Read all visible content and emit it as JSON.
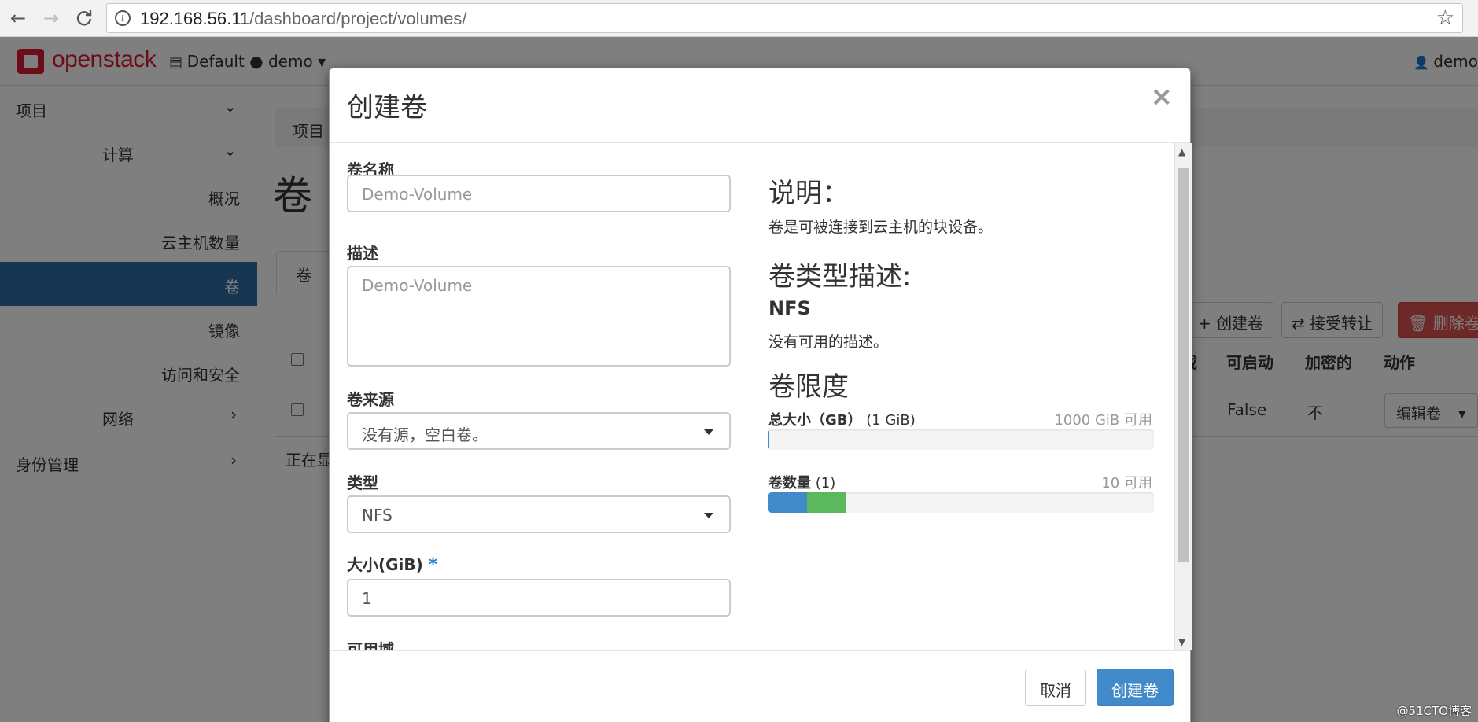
{
  "browser": {
    "back": "←",
    "forward": "→",
    "reload": "C",
    "info": "i",
    "url_host": "192.168.56.11",
    "url_path": "/dashboard/project/volumes/",
    "star": "☆"
  },
  "navbar": {
    "logo": "openstack",
    "project_selector": "Default ● demo ▾",
    "user": "demo"
  },
  "sidebar": {
    "items": [
      {
        "label": "项目",
        "chevron": "⌄"
      },
      {
        "label": "计算",
        "chevron": "⌄"
      },
      {
        "label": "概况"
      },
      {
        "label": "云主机数量"
      },
      {
        "label": "卷"
      },
      {
        "label": "镜像"
      },
      {
        "label": "访问和安全"
      },
      {
        "label": "网络",
        "chevron": "›"
      },
      {
        "label": "身份管理",
        "chevron": "›"
      }
    ]
  },
  "page": {
    "breadcrumb": "项目",
    "title": "卷",
    "tab": "卷",
    "actions": {
      "create": "+ 创建卷",
      "accept_transfer": "⇄ 接受转让",
      "delete": "🗑 删除卷"
    },
    "columns": [
      "载",
      "可启动",
      "加密的",
      "动作"
    ],
    "row": {
      "bootable": "False",
      "encrypted": "不",
      "action": "编辑卷",
      "caret": "▾"
    },
    "showing": "正在显"
  },
  "modal": {
    "title": "创建卷",
    "close": "×",
    "fields": {
      "name_label": "卷名称",
      "name_placeholder": "Demo-Volume",
      "desc_label": "描述",
      "desc_placeholder": "Demo-Volume",
      "source_label": "卷来源",
      "source_value": "没有源，空白卷。",
      "type_label": "类型",
      "type_value": "NFS",
      "size_label": "大小(GiB)",
      "size_required": "*",
      "size_value": "1",
      "az_label": "可用域"
    },
    "help": {
      "desc_heading": "说明：",
      "desc_text": "卷是可被连接到云主机的块设备。",
      "type_heading": "卷类型描述:",
      "type_name": "NFS",
      "type_text": "没有可用的描述。",
      "limits_heading": "卷限度"
    },
    "quota": {
      "total_size_label": "总大小（GB）",
      "total_size_used": "(1 GiB)",
      "total_size_avail": "1000 GiB 可用",
      "total_size_fraction": 0.001,
      "count_label": "卷数量",
      "count_used": "(1)",
      "count_avail": "10 可用",
      "count_used_fraction": 0.1,
      "count_new_fraction": 0.1,
      "color_used": "#428bca",
      "color_new": "#5cb85c"
    },
    "footer": {
      "cancel": "取消",
      "submit": "创建卷"
    }
  },
  "watermark": "@51CTO博客"
}
